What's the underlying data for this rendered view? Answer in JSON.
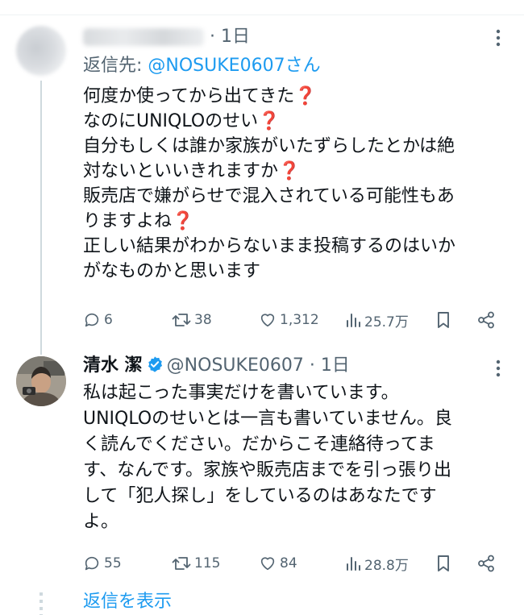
{
  "tweet1": {
    "time": "1日",
    "reply_prefix": "返信先: ",
    "reply_handle": "@NOSUKE0607さん",
    "lines": [
      {
        "text": "何度か使ってから出てきた",
        "q": "❓"
      },
      {
        "text": "なのにUNIQLOのせい",
        "q": "❓"
      },
      {
        "text": "自分もしくは誰か家族がいたずらしたとかは絶",
        "q": ""
      },
      {
        "text": "対ないといいきれますか",
        "q": "❓"
      },
      {
        "text": "販売店で嫌がらせで混入されている可能性もあ",
        "q": ""
      },
      {
        "text": "りますよね",
        "q": "❓"
      },
      {
        "text": "正しい結果がわからないまま投稿するのはいか",
        "q": ""
      },
      {
        "text": "がなものかと思います",
        "q": ""
      }
    ],
    "stats": {
      "replies": "6",
      "reposts": "38",
      "likes": "1,312",
      "views": "25.7万"
    }
  },
  "tweet2": {
    "name": "清水 潔",
    "handle": "@NOSUKE0607",
    "sep": " · ",
    "time": "1日",
    "lines": [
      "私は起こった事実だけを書いています。",
      "UNIQLOのせいとは一言も書いていません。良",
      "く読んでください。だからこそ連絡待ってま",
      "す、なんです。家族や販売店までを引っ張り出",
      "して「犯人探し」をしているのはあなたです",
      "よ。"
    ],
    "stats": {
      "replies": "55",
      "reposts": "115",
      "likes": "84",
      "views": "28.8万"
    }
  },
  "show_replies": "返信を表示",
  "colors": {
    "accent": "#1d9bf0",
    "muted": "#536471",
    "text": "#0f1419",
    "line": "#cfd9de"
  }
}
